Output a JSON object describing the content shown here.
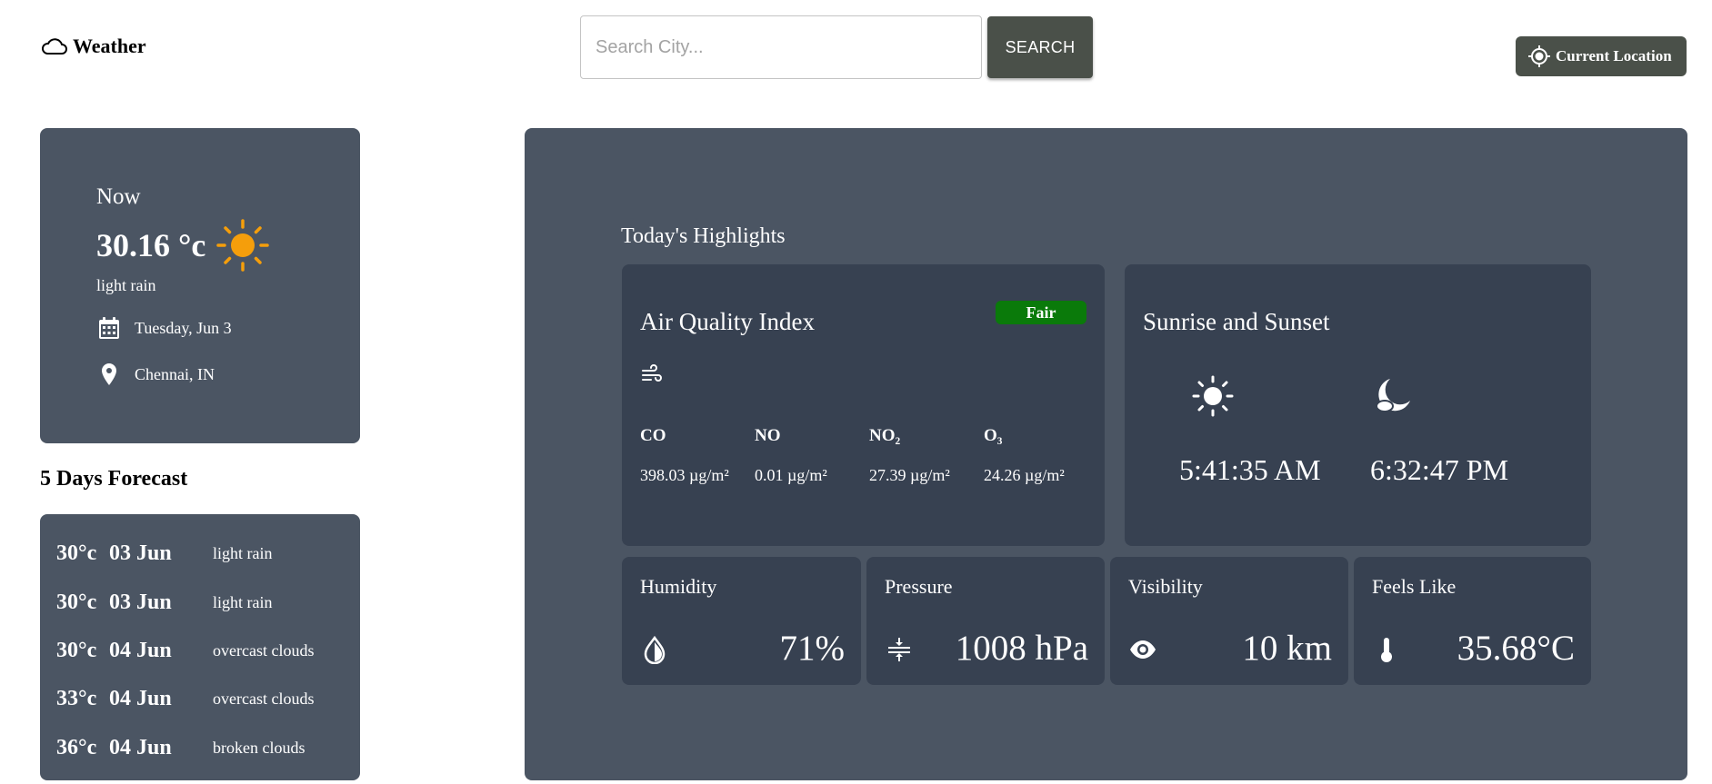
{
  "header": {
    "app_title": "Weather",
    "search_placeholder": "Search City...",
    "search_value": "",
    "search_button": "SEARCH",
    "location_button": "Current Location"
  },
  "current": {
    "label": "Now",
    "temperature": "30.16 °c",
    "description": "light rain",
    "date": "Tuesday, Jun 3",
    "location": "Chennai, IN",
    "icon": "sun-icon"
  },
  "forecast": {
    "title": "5 Days Forecast",
    "days": [
      {
        "temp": "30°c",
        "date": "03 Jun",
        "desc": "light rain"
      },
      {
        "temp": "30°c",
        "date": "03 Jun",
        "desc": "light rain"
      },
      {
        "temp": "30°c",
        "date": "04 Jun",
        "desc": "overcast clouds"
      },
      {
        "temp": "33°c",
        "date": "04 Jun",
        "desc": "overcast clouds"
      },
      {
        "temp": "36°c",
        "date": "04 Jun",
        "desc": "broken clouds"
      }
    ]
  },
  "highlights": {
    "title": "Today's Highlights",
    "aqi": {
      "title": "Air Quality Index",
      "badge": "Fair",
      "badge_color": "#0a7a0a",
      "pollutants": [
        {
          "name": "CO",
          "value": "398.03 µg/m²"
        },
        {
          "name": "NO",
          "value": "0.01 µg/m²"
        },
        {
          "name": "NO₂",
          "value": "27.39 µg/m²"
        },
        {
          "name": "O₃",
          "value": "24.26 µg/m²"
        }
      ]
    },
    "sun": {
      "title": "Sunrise and Sunset",
      "sunrise": "5:41:35 AM",
      "sunset": "6:32:47 PM"
    },
    "stats": {
      "humidity": {
        "label": "Humidity",
        "value": "71%",
        "icon": "water-drop-icon"
      },
      "pressure": {
        "label": "Pressure",
        "value": "1008 hPa",
        "icon": "compress-icon"
      },
      "visibility": {
        "label": "Visibility",
        "value": "10 km",
        "icon": "eye-icon"
      },
      "feels_like": {
        "label": "Feels Like",
        "value": "35.68°C",
        "icon": "thermometer-icon"
      }
    }
  },
  "colors": {
    "card_bg": "#4b5563",
    "inner_card_bg": "#374151",
    "button_bg": "#4a5049",
    "sun_accent": "#f59e0b"
  }
}
